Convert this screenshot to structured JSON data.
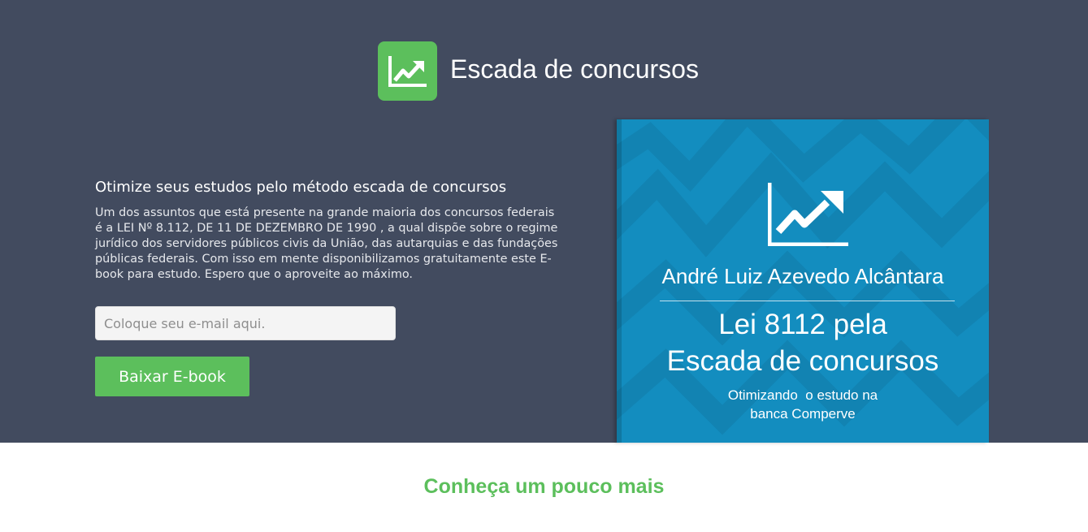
{
  "brand": {
    "title": "Escada de concursos",
    "logo_icon": "trending-up-chart-icon",
    "accent_color": "#5cbf5c",
    "hero_background": "#424b5f"
  },
  "hero": {
    "headline": "Otimize seus estudos pelo método escada de concursos",
    "description": "Um dos assuntos que está presente na grande maioria dos concursos federais é a LEI Nº 8.112, DE 11 DE DEZEMBRO DE 1990 , a qual dispõe sobre o regime jurídico dos servidores públicos civis da União, das autarquias e das fundações públicas federais. Com isso em mente disponibilizamos gratuitamente este E-book para estudo. Espero que o aproveite ao máximo.",
    "email_placeholder": "Coloque seu e-mail aqui.",
    "email_value": "",
    "download_label": "Baixar E-book"
  },
  "book_cover": {
    "icon": "trending-up-chart-icon",
    "author": "André Luiz Azevedo Alcântara",
    "title_line1": "Lei 8112 pela",
    "title_line2": "Escada de concursos",
    "subtitle_line1": "Otimizando  o estudo na",
    "subtitle_line2": "banca Comperve",
    "background_color": "#138dbf"
  },
  "section": {
    "heading": "Conheça um pouco mais"
  }
}
